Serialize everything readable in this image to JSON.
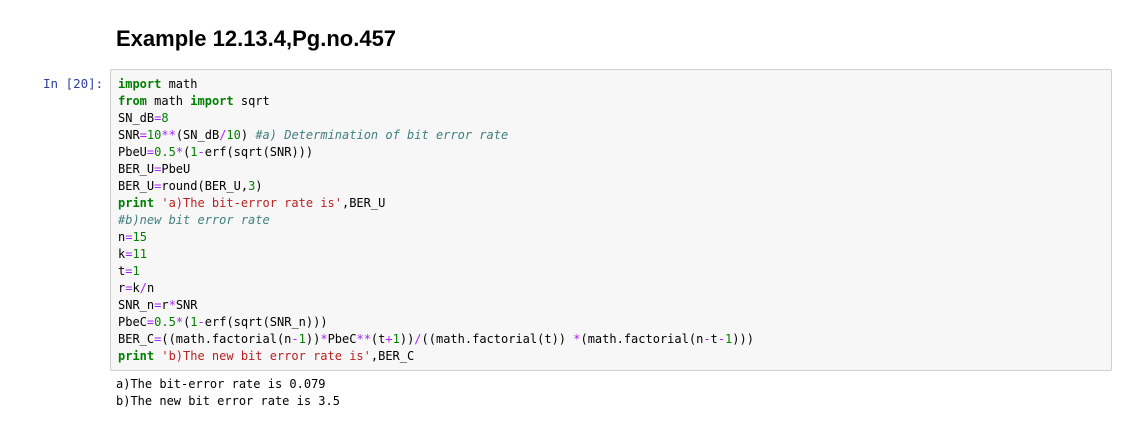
{
  "heading": "Example 12.13.4,Pg.no.457",
  "cell": {
    "prompt": "In [20]:",
    "code_lines": [
      [
        {
          "t": "kw",
          "v": "import"
        },
        {
          "t": "plain",
          "v": " math"
        }
      ],
      [
        {
          "t": "kw",
          "v": "from"
        },
        {
          "t": "plain",
          "v": " math "
        },
        {
          "t": "kw",
          "v": "import"
        },
        {
          "t": "plain",
          "v": " sqrt"
        }
      ],
      [
        {
          "t": "plain",
          "v": "SN_dB"
        },
        {
          "t": "op",
          "v": "="
        },
        {
          "t": "num",
          "v": "8"
        }
      ],
      [
        {
          "t": "plain",
          "v": "SNR"
        },
        {
          "t": "op",
          "v": "="
        },
        {
          "t": "num",
          "v": "10"
        },
        {
          "t": "op",
          "v": "**"
        },
        {
          "t": "plain",
          "v": "(SN_dB"
        },
        {
          "t": "op",
          "v": "/"
        },
        {
          "t": "num",
          "v": "10"
        },
        {
          "t": "plain",
          "v": ") "
        },
        {
          "t": "cm",
          "v": "#a) Determination of bit error rate"
        }
      ],
      [
        {
          "t": "plain",
          "v": "PbeU"
        },
        {
          "t": "op",
          "v": "="
        },
        {
          "t": "num",
          "v": "0.5"
        },
        {
          "t": "op",
          "v": "*"
        },
        {
          "t": "plain",
          "v": "("
        },
        {
          "t": "num",
          "v": "1"
        },
        {
          "t": "op",
          "v": "-"
        },
        {
          "t": "plain",
          "v": "erf(sqrt(SNR)))"
        }
      ],
      [
        {
          "t": "plain",
          "v": "BER_U"
        },
        {
          "t": "op",
          "v": "="
        },
        {
          "t": "plain",
          "v": "PbeU"
        }
      ],
      [
        {
          "t": "plain",
          "v": "BER_U"
        },
        {
          "t": "op",
          "v": "="
        },
        {
          "t": "plain",
          "v": "round(BER_U,"
        },
        {
          "t": "num",
          "v": "3"
        },
        {
          "t": "plain",
          "v": ")"
        }
      ],
      [
        {
          "t": "kw",
          "v": "print"
        },
        {
          "t": "plain",
          "v": " "
        },
        {
          "t": "str",
          "v": "'a)The bit-error rate is'"
        },
        {
          "t": "plain",
          "v": ",BER_U"
        }
      ],
      [
        {
          "t": "cm",
          "v": "#b)new bit error rate"
        }
      ],
      [
        {
          "t": "plain",
          "v": "n"
        },
        {
          "t": "op",
          "v": "="
        },
        {
          "t": "num",
          "v": "15"
        }
      ],
      [
        {
          "t": "plain",
          "v": "k"
        },
        {
          "t": "op",
          "v": "="
        },
        {
          "t": "num",
          "v": "11"
        }
      ],
      [
        {
          "t": "plain",
          "v": "t"
        },
        {
          "t": "op",
          "v": "="
        },
        {
          "t": "num",
          "v": "1"
        }
      ],
      [
        {
          "t": "plain",
          "v": "r"
        },
        {
          "t": "op",
          "v": "="
        },
        {
          "t": "plain",
          "v": "k"
        },
        {
          "t": "op",
          "v": "/"
        },
        {
          "t": "plain",
          "v": "n"
        }
      ],
      [
        {
          "t": "plain",
          "v": "SNR_n"
        },
        {
          "t": "op",
          "v": "="
        },
        {
          "t": "plain",
          "v": "r"
        },
        {
          "t": "op",
          "v": "*"
        },
        {
          "t": "plain",
          "v": "SNR"
        }
      ],
      [
        {
          "t": "plain",
          "v": "PbeC"
        },
        {
          "t": "op",
          "v": "="
        },
        {
          "t": "num",
          "v": "0.5"
        },
        {
          "t": "op",
          "v": "*"
        },
        {
          "t": "plain",
          "v": "("
        },
        {
          "t": "num",
          "v": "1"
        },
        {
          "t": "op",
          "v": "-"
        },
        {
          "t": "plain",
          "v": "erf(sqrt(SNR_n)))"
        }
      ],
      [
        {
          "t": "plain",
          "v": "BER_C"
        },
        {
          "t": "op",
          "v": "="
        },
        {
          "t": "plain",
          "v": "((math.factorial(n"
        },
        {
          "t": "op",
          "v": "-"
        },
        {
          "t": "num",
          "v": "1"
        },
        {
          "t": "plain",
          "v": "))"
        },
        {
          "t": "op",
          "v": "*"
        },
        {
          "t": "plain",
          "v": "PbeC"
        },
        {
          "t": "op",
          "v": "**"
        },
        {
          "t": "plain",
          "v": "(t"
        },
        {
          "t": "op",
          "v": "+"
        },
        {
          "t": "num",
          "v": "1"
        },
        {
          "t": "plain",
          "v": "))"
        },
        {
          "t": "op",
          "v": "/"
        },
        {
          "t": "plain",
          "v": "((math.factorial(t)) "
        },
        {
          "t": "op",
          "v": "*"
        },
        {
          "t": "plain",
          "v": "(math.factorial(n"
        },
        {
          "t": "op",
          "v": "-"
        },
        {
          "t": "plain",
          "v": "t"
        },
        {
          "t": "op",
          "v": "-"
        },
        {
          "t": "num",
          "v": "1"
        },
        {
          "t": "plain",
          "v": ")))"
        }
      ],
      [
        {
          "t": "kw",
          "v": "print"
        },
        {
          "t": "plain",
          "v": " "
        },
        {
          "t": "str",
          "v": "'b)The new bit error rate is'"
        },
        {
          "t": "plain",
          "v": ",BER_C"
        }
      ]
    ],
    "output_lines": [
      "a)The bit-error rate is 0.079",
      "b)The new bit error rate is 3.5"
    ]
  },
  "colors": {
    "keyword": "#008000",
    "number": "#008000",
    "operator": "#aa22ff",
    "string": "#ba2121",
    "comment": "#408080",
    "prompt": "#303f9f",
    "input_background": "#f7f7f7",
    "input_border": "#cfcfcf"
  }
}
